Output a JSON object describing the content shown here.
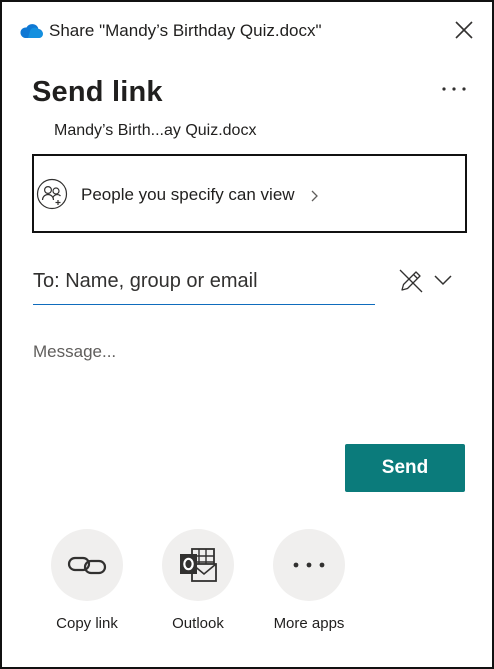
{
  "window": {
    "title": "Share \"Mandy’s Birthday Quiz.docx\""
  },
  "header": {
    "heading": "Send link",
    "file_name": "Mandy’s Birth...ay Quiz.docx"
  },
  "permissions": {
    "label": "People you specify can view"
  },
  "recipient": {
    "placeholder": "To: Name, group or email"
  },
  "message": {
    "placeholder": "Message..."
  },
  "send": {
    "label": "Send"
  },
  "share_apps": [
    {
      "label": "Copy link",
      "icon": "link-icon"
    },
    {
      "label": "Outlook",
      "icon": "outlook-icon"
    },
    {
      "label": "More apps",
      "icon": "more-icon"
    }
  ],
  "colors": {
    "accent": "#0b7b7b",
    "field_underline": "#0f6cbd",
    "onedrive": "#0f78d4"
  }
}
